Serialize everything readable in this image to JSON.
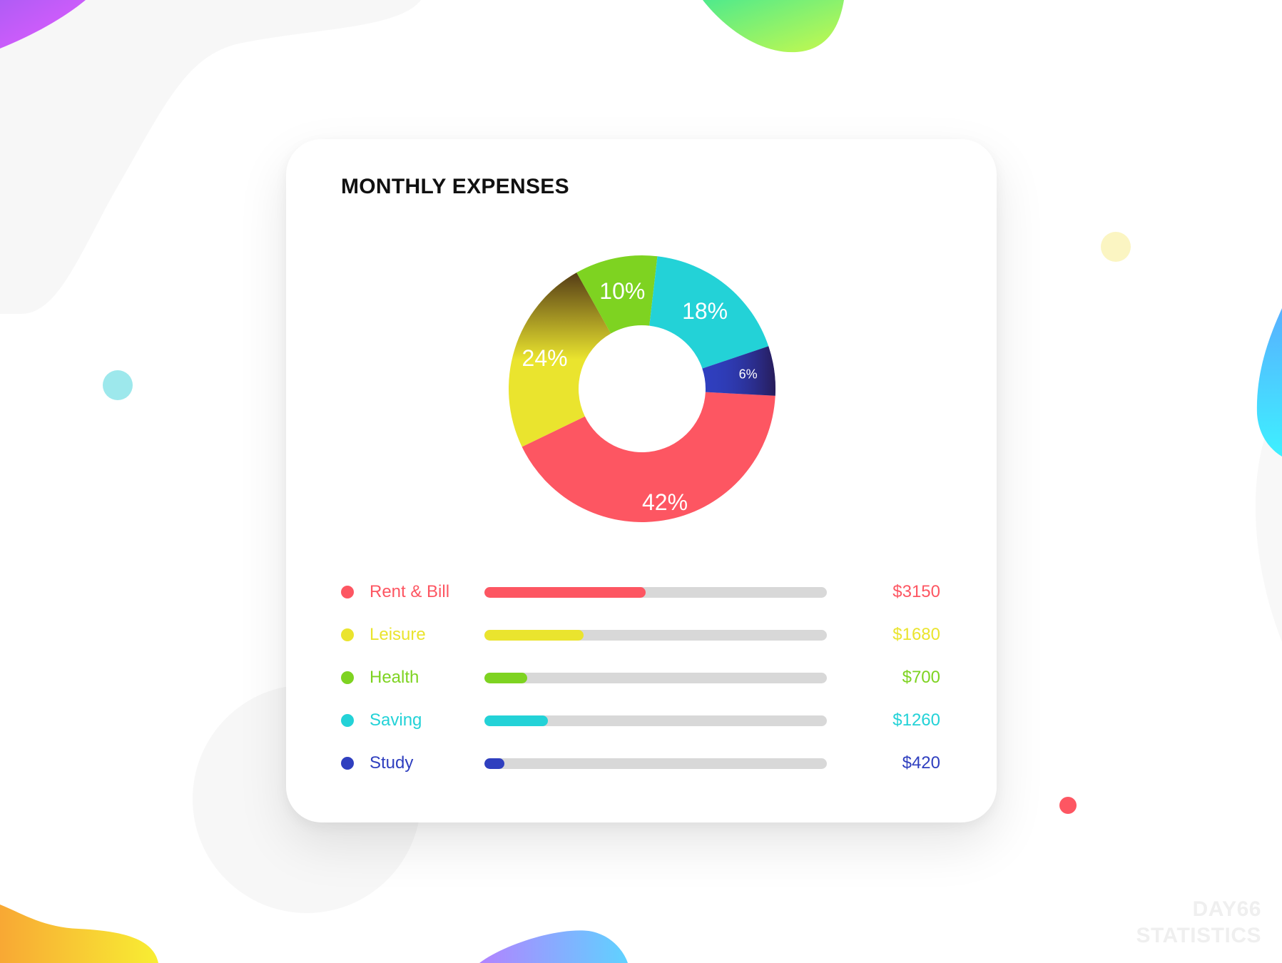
{
  "card": {
    "title": "MONTHLY EXPENSES"
  },
  "chart_data": {
    "type": "pie",
    "title": "MONTHLY EXPENSES",
    "slices": [
      {
        "name": "Rent & Bill",
        "percent": 42,
        "label": "42%",
        "color": "#FD5662"
      },
      {
        "name": "Leisure",
        "percent": 24,
        "label": "24%",
        "color": "#EAE42E"
      },
      {
        "name": "Health",
        "percent": 10,
        "label": "10%",
        "color": "#7ED321"
      },
      {
        "name": "Saving",
        "percent": 18,
        "label": "18%",
        "color": "#23D2D7"
      },
      {
        "name": "Study",
        "percent": 6,
        "label": "6%",
        "color": "#2F3FBF"
      }
    ]
  },
  "legend": [
    {
      "label": "Rent & Bill",
      "amount": "$3150",
      "value": 3150,
      "fill_fraction": 0.47,
      "color": "#FD5662"
    },
    {
      "label": "Leisure",
      "amount": "$1680",
      "value": 1680,
      "fill_fraction": 0.29,
      "color": "#EAE42E"
    },
    {
      "label": "Health",
      "amount": "$700",
      "value": 700,
      "fill_fraction": 0.125,
      "color": "#7ED321"
    },
    {
      "label": "Saving",
      "amount": "$1260",
      "value": 1260,
      "fill_fraction": 0.185,
      "color": "#23D2D7"
    },
    {
      "label": "Study",
      "amount": "$420",
      "value": 420,
      "fill_fraction": 0.058,
      "color": "#2F3FBF"
    }
  ],
  "watermark": {
    "line1": "DAY66",
    "line2": "STATISTICS"
  }
}
